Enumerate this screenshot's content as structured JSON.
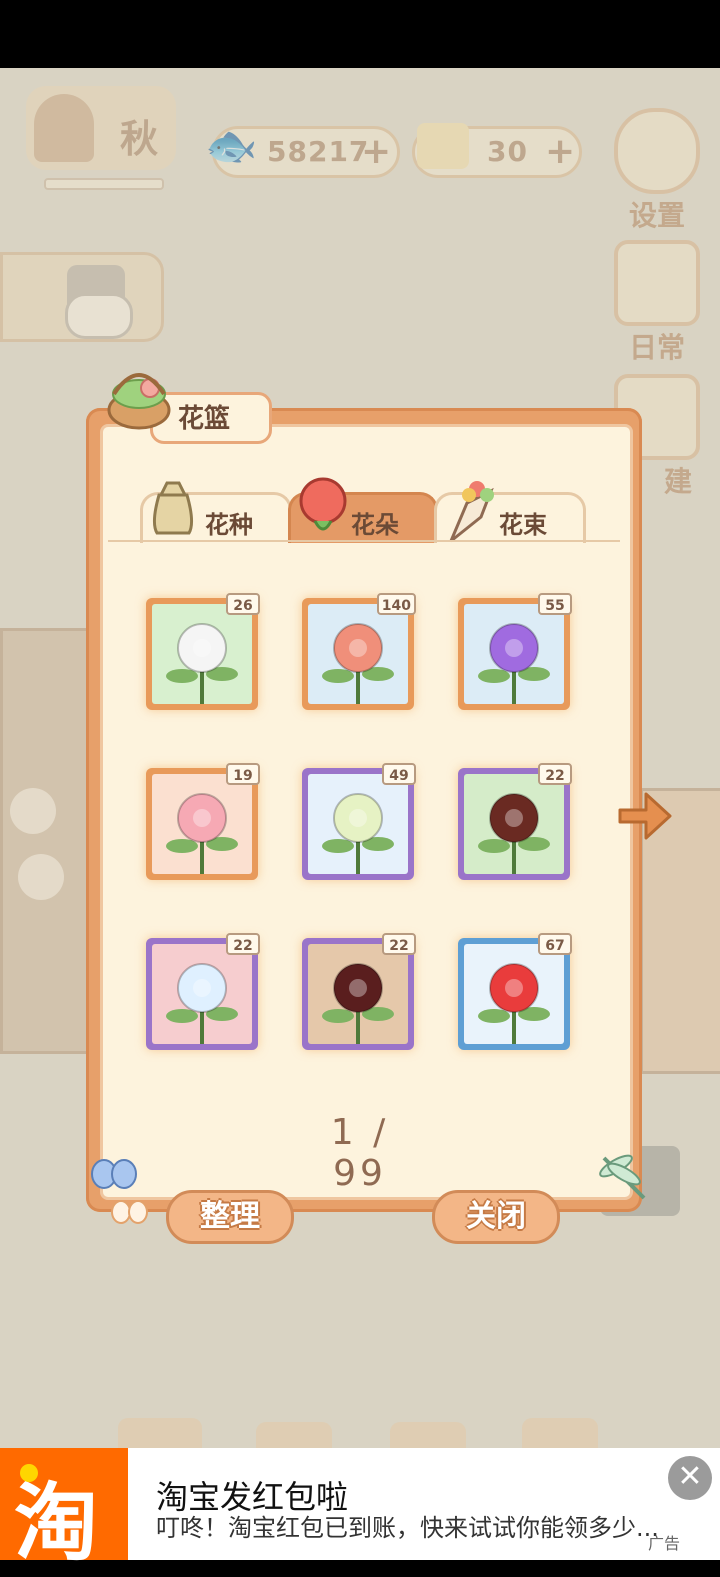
{
  "hud": {
    "season": "秋",
    "fish_count": "58217",
    "cheese_count": "30",
    "settings_label": "设置",
    "daily_label": "日常",
    "build_label": "建"
  },
  "panel": {
    "title": "花篮",
    "tabs": [
      {
        "label": "花种",
        "active": false
      },
      {
        "label": "花朵",
        "active": true
      },
      {
        "label": "花束",
        "active": false
      }
    ],
    "items": [
      {
        "count": "26",
        "bg": "#d8f0cf",
        "frame": "#e89a5a"
      },
      {
        "count": "140",
        "bg": "#dcecf6",
        "frame": "#e89a5a"
      },
      {
        "count": "55",
        "bg": "#dcecf6",
        "frame": "#e89a5a"
      },
      {
        "count": "19",
        "bg": "#fbe0d0",
        "frame": "#e89a5a"
      },
      {
        "count": "49",
        "bg": "#e6f1fb",
        "frame": "#9a74c9"
      },
      {
        "count": "22",
        "bg": "#d5ecc9",
        "frame": "#9a74c9"
      },
      {
        "count": "22",
        "bg": "#f6cdcf",
        "frame": "#9a74c9"
      },
      {
        "count": "22",
        "bg": "#e5c8aa",
        "frame": "#9a74c9"
      },
      {
        "count": "67",
        "bg": "#e9f3fb",
        "frame": "#5e9fd4"
      }
    ],
    "page_indicator": "1 / 99",
    "sort_button": "整理",
    "close_button": "关闭"
  },
  "ad": {
    "logo": "淘",
    "title": "淘宝发红包啦",
    "description": "叮咚！淘宝红包已到账，快来试试你能领多少...",
    "tag": "广告",
    "close": "✕"
  }
}
